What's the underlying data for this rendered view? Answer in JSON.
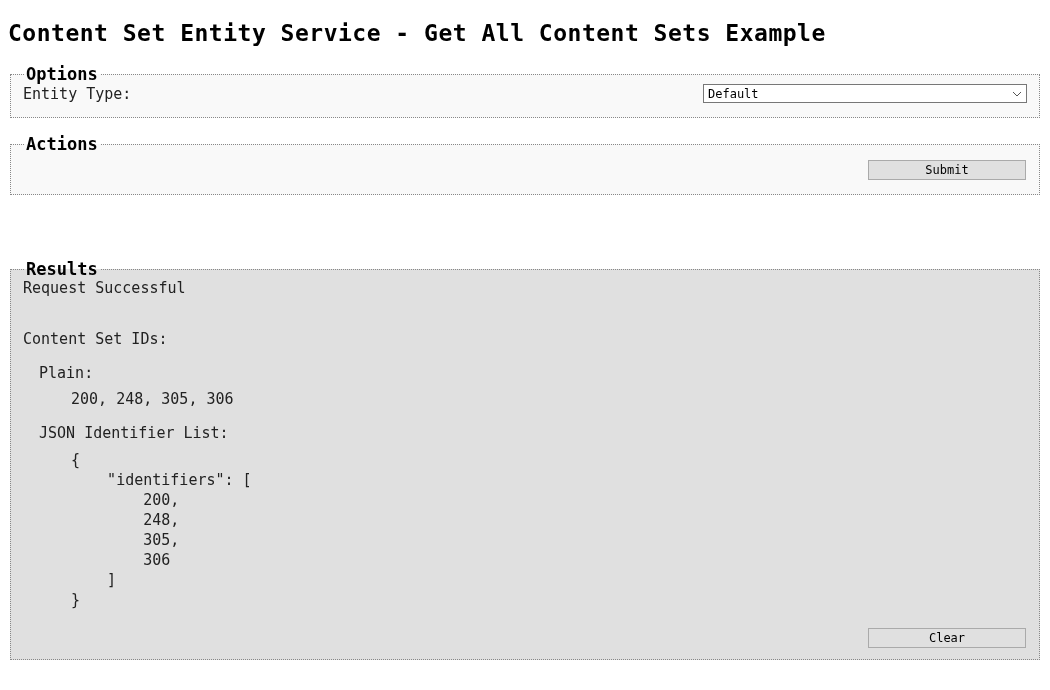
{
  "title": "Content Set Entity Service - Get All Content Sets Example",
  "options": {
    "legend": "Options",
    "entity_type": {
      "label": "Entity Type:",
      "value": "Default"
    }
  },
  "actions": {
    "legend": "Actions",
    "buttons": [
      "Submit"
    ]
  },
  "results": {
    "legend": "Results",
    "status": "Request Successful",
    "heading": "Content Set IDs:",
    "plain_label": "Plain:",
    "plain_value": "200, 248, 305, 306",
    "json_label": "JSON Identifier List:",
    "json_lines": [
      "{",
      "    \"identifiers\": [",
      "        200,",
      "        248,",
      "        305,",
      "        306",
      "    ]",
      "}"
    ],
    "buttons": [
      "Clear"
    ]
  }
}
